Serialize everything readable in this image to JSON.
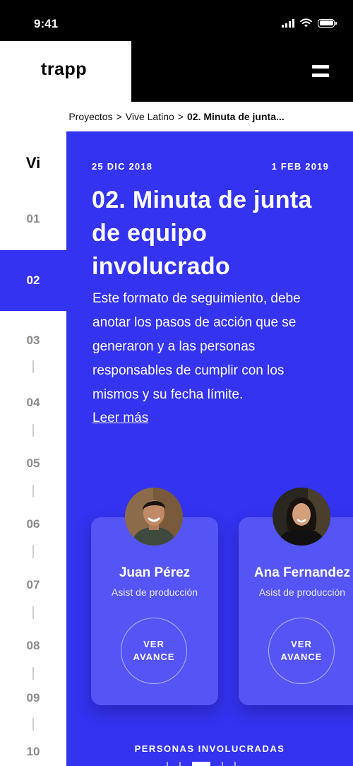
{
  "status_bar": {
    "time": "9:41",
    "icons": [
      "signal-icon",
      "wifi-icon",
      "battery-icon"
    ]
  },
  "header": {
    "logo": "trapp",
    "menu_icon": "hamburger-icon"
  },
  "breadcrumb": {
    "items": [
      "Proyectos",
      "Vive Latino"
    ],
    "separator": ">",
    "current": "02. Minuta de junta..."
  },
  "index": {
    "heading": "Vi",
    "items": [
      "01",
      "02",
      "03",
      "04",
      "05",
      "06",
      "07",
      "08",
      "09",
      "10"
    ],
    "active": "02"
  },
  "panel": {
    "date_start": "25 DIC 2018",
    "date_end": "1 FEB 2019",
    "title": "02. Minuta de junta de equipo involucrado",
    "description": "Este formato de seguimiento, debe anotar los pasos de acción que se generaron y a las personas responsables de cumplir con los mismos y su fecha límite.",
    "read_more": "Leer más"
  },
  "people": [
    {
      "name": "Juan Pérez",
      "role": "Asist de producción",
      "button": "VER AVANCE"
    },
    {
      "name": "Ana Fernandez",
      "role": "Asist de producción",
      "button": "VER AVANCE"
    }
  ],
  "section_label": "PERSONAS INVOLUCRADAS",
  "colors": {
    "accent": "#3333f0",
    "card": "#5555f5",
    "header": "#000000"
  }
}
